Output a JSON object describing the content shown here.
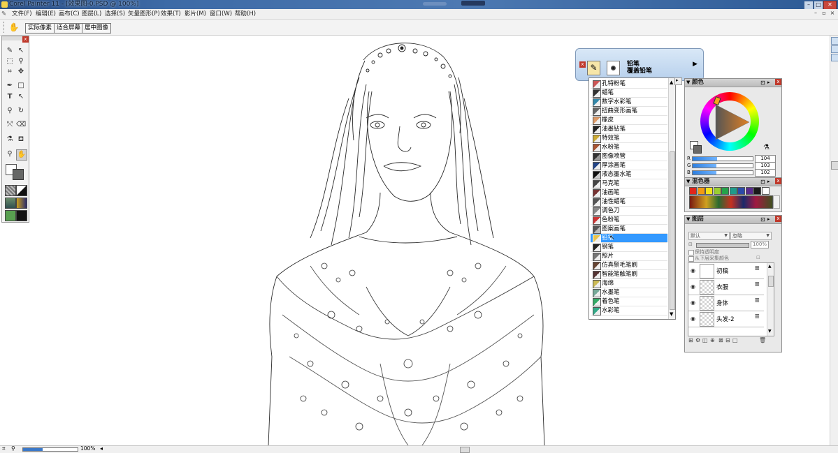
{
  "window": {
    "title": "Corel Painter 11 - [效果图-0.PSD @ 100%]",
    "controls": {
      "minimize": "–",
      "maximize": "□",
      "close": "✕"
    }
  },
  "menu": [
    "文件(F)",
    "编辑(E)",
    "画布(C)",
    "图层(L)",
    "选择(S)",
    "矢量图形(P)",
    "效果(T)",
    "影片(M)",
    "窗口(W)",
    "帮助(H)"
  ],
  "propertybar": {
    "buttons": [
      "实际像素",
      "适合屏幕",
      "居中图像"
    ]
  },
  "brush_selector": {
    "category": "铅笔",
    "variant": "覆盖铅笔",
    "list": [
      "孔特粉笔",
      "蜡笔",
      "数字水彩笔",
      "扭曲变形画笔",
      "橡皮",
      "油墨钻笔",
      "特效笔",
      "水粉笔",
      "图像喷管",
      "厚涂画笔",
      "液态墨水笔",
      "马克笔",
      "油画笔",
      "油性蜡笔",
      "调色刀",
      "色粉笔",
      "图案画笔",
      "铅笔",
      "钢笔",
      "照片",
      "仿真鬃毛笔刷",
      "智能笔触笔刷",
      "海绵",
      "水墨笔",
      "着色笔",
      "水彩笔"
    ],
    "selected": "铅笔"
  },
  "colors_panel": {
    "title": "颜色",
    "r": "104",
    "g": "103",
    "b": "102",
    "r_label": "R",
    "g_label": "G",
    "b_label": "B",
    "r_level": 0.41,
    "g_level": 0.4,
    "b_level": 0.4
  },
  "mixer_panel": {
    "title": "混色器",
    "swatches": [
      "#e0261c",
      "#f39a12",
      "#f2e21a",
      "#9acd32",
      "#24a24a",
      "#1f9a8a",
      "#2c4aa8",
      "#5a2a8e",
      "#1a1a1a",
      "#ffffff"
    ]
  },
  "layers_panel": {
    "title": "图层",
    "composite_method": "默认",
    "composite_depth": "忽略",
    "opacity": "100%",
    "preserve_transparency": "保持透明度",
    "pick_up_color": "从下层采集颜色",
    "layers": [
      "初稿",
      "衣服",
      "身体",
      "头发-2"
    ]
  },
  "status": {
    "zoom": "100%"
  },
  "colors": {
    "accent": "#3399ff",
    "titlebar": "#3d6aa6"
  }
}
